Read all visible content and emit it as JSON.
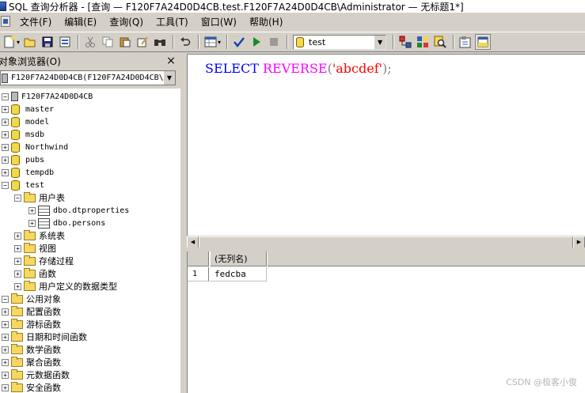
{
  "window": {
    "title": "SQL 查询分析器 - [查询 — F120F7A24D0D4CB.test.F120F7A24D0D4CB\\Administrator — 无标题1*]"
  },
  "menu": {
    "items": [
      "文件(F)",
      "编辑(E)",
      "查询(Q)",
      "工具(T)",
      "窗口(W)",
      "帮助(H)"
    ]
  },
  "toolbar": {
    "database": "test",
    "icons": [
      "new-query-icon",
      "open-icon",
      "save-icon",
      "insert-template-icon",
      "cut-icon",
      "copy-icon",
      "paste-icon",
      "clear-icon",
      "find-icon",
      "undo-icon",
      "results-mode-icon",
      "parse-icon",
      "execute-icon",
      "stop-icon",
      "object-browser-icon",
      "object-search-icon",
      "properties-icon",
      "results-pane-icon"
    ]
  },
  "object_browser": {
    "title": "对象浏览器(O)",
    "close": "×",
    "server_select": "F120F7A24D0D4CB(F120F7A24D0D4CB\\",
    "tree": {
      "server": "F120F7A24D0D4CB",
      "databases": [
        "master",
        "model",
        "msdb",
        "Northwind",
        "pubs",
        "tempdb",
        "test"
      ],
      "test_children": {
        "user_tables": "用户表",
        "tables": [
          "dbo.dtproperties",
          "dbo.persons"
        ],
        "system_tables": "系统表",
        "views": "视图",
        "stored_procedures": "存储过程",
        "functions": "函数",
        "user_types": "用户定义的数据类型"
      },
      "common_objects": "公用对象",
      "common_children": [
        "配置函数",
        "游标函数",
        "日期和时间函数",
        "数学函数",
        "聚合函数",
        "元数据函数",
        "安全函数"
      ]
    }
  },
  "editor": {
    "keyword": "SELECT",
    "function": "REVERSE",
    "open_paren": "(",
    "string": "'abcdef'",
    "close": ");"
  },
  "results": {
    "column": "(无列名)",
    "rows": [
      {
        "num": "1",
        "value": "fedcba"
      }
    ]
  },
  "watermark": "CSDN @极客小俊",
  "colors": {
    "keyword": "#0000ff",
    "function": "#ff00ff",
    "string": "#ff0000",
    "punctuation": "#808080"
  }
}
